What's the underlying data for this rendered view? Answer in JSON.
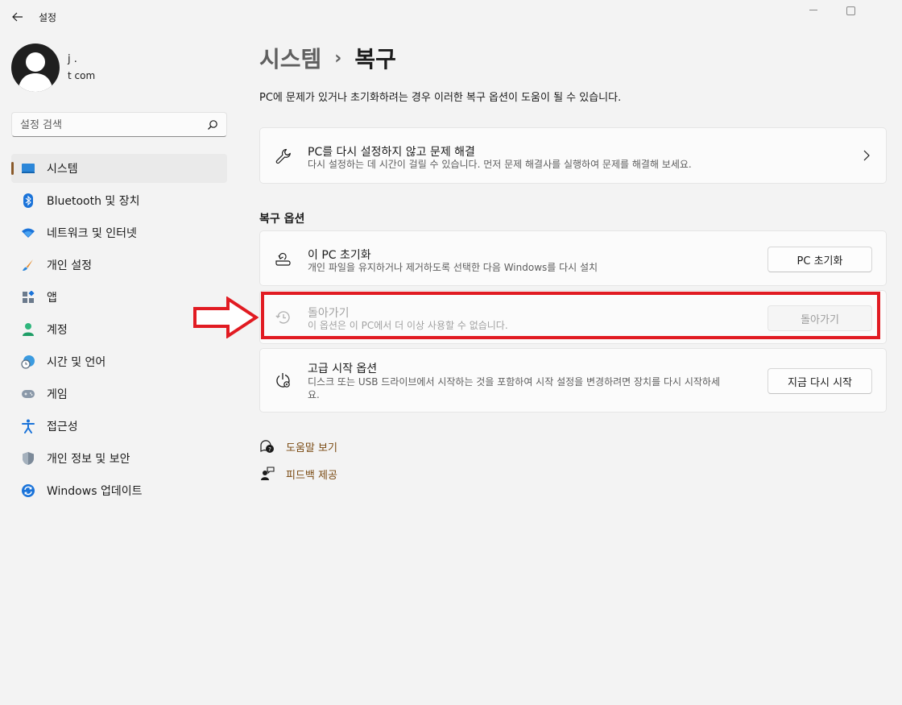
{
  "window": {
    "title": "설정"
  },
  "profile": {
    "name": "j         .",
    "email": "t                         com"
  },
  "search": {
    "placeholder": "설정 검색"
  },
  "sidebar": {
    "items": [
      {
        "label": "시스템",
        "icon": "system-icon",
        "active": true
      },
      {
        "label": "Bluetooth 및 장치",
        "icon": "bluetooth-icon"
      },
      {
        "label": "네트워크 및 인터넷",
        "icon": "wifi-icon"
      },
      {
        "label": "개인 설정",
        "icon": "brush-icon"
      },
      {
        "label": "앱",
        "icon": "apps-icon"
      },
      {
        "label": "계정",
        "icon": "account-icon"
      },
      {
        "label": "시간 및 언어",
        "icon": "globe-clock-icon"
      },
      {
        "label": "게임",
        "icon": "gamepad-icon"
      },
      {
        "label": "접근성",
        "icon": "accessibility-icon"
      },
      {
        "label": "개인 정보 및 보안",
        "icon": "shield-icon"
      },
      {
        "label": "Windows 업데이트",
        "icon": "update-icon"
      }
    ]
  },
  "header": {
    "parent": "시스템",
    "separator": "›",
    "current": "복구",
    "description": "PC에 문제가 있거나 초기화하려는 경우 이러한 복구 옵션이 도움이 될 수 있습니다."
  },
  "troubleshoot": {
    "title": "PC를 다시 설정하지 않고 문제 해결",
    "subtitle": "다시 설정하는 데 시간이 걸릴 수 있습니다. 먼저 문제 해결사를 실행하여 문제를 해결해 보세요."
  },
  "recovery_options": {
    "section_title": "복구 옵션",
    "reset": {
      "title": "이 PC 초기화",
      "subtitle": "개인 파일을 유지하거나 제거하도록 선택한 다음 Windows를 다시 설치",
      "button": "PC 초기화"
    },
    "go_back": {
      "title": "돌아가기",
      "subtitle": "이 옵션은 이 PC에서 더 이상 사용할 수 없습니다.",
      "button": "돌아가기",
      "disabled": true
    },
    "advanced": {
      "title": "고급 시작 옵션",
      "subtitle_line1": "디스크 또는 USB 드라이브에서 시작하는 것을 포함하여 시작 설정을 변경하려면 장치를 다시 시작하세",
      "subtitle_line2": "요.",
      "button": "지금 다시 시작"
    }
  },
  "links": {
    "help": "도움말 보기",
    "feedback": "피드백 제공"
  },
  "colors": {
    "accent": "#8a5a2a",
    "annotation": "#e11b22",
    "link": "#7a4a12"
  }
}
